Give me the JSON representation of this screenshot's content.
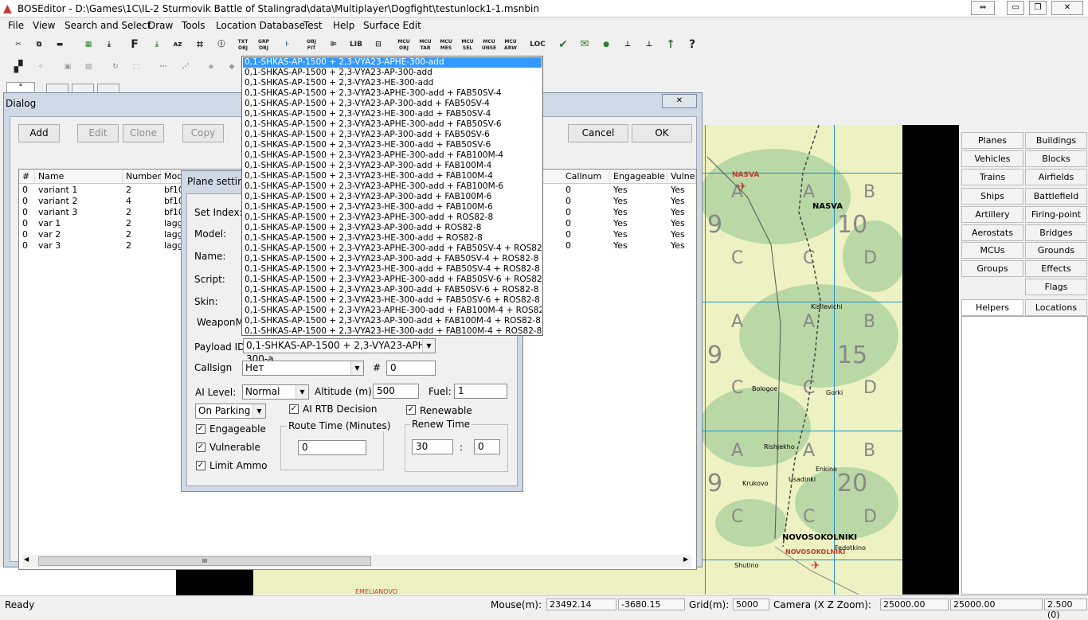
{
  "window": {
    "title": "BOSEditor - D:\\Games\\1C\\IL-2 Sturmovik Battle of Stalingrad\\data\\Multiplayer\\Dogfight\\testunlock1-1.msnbin",
    "ctrl_restore": "⇔",
    "min": "▭",
    "max": "❐",
    "close": "✕"
  },
  "menu": [
    "File",
    "View",
    "Search and Select",
    "Draw",
    "Tools",
    "Location Database",
    "Test",
    "Help",
    "Surface Edit"
  ],
  "toolbar1": [
    "✂",
    "⧉",
    "▬",
    "▦",
    "⤓",
    "F",
    "⤓",
    "ᴀᴢ",
    "⌗",
    "ⓘ",
    "TXT OBJ",
    "GRP OBJ",
    "⊦",
    "OBJ FIT",
    "⊫",
    "LIB",
    "⊟",
    "MCU OBJ",
    "MCU TAR",
    "MCU MES",
    "MCU SEL",
    "MCU UNSE",
    "MCU ARW",
    "LOC",
    "✔",
    "✉",
    "●",
    "⊥",
    "⊥",
    "↑",
    "?"
  ],
  "dialog": {
    "title": "Dialog",
    "close": "✕",
    "buttons": {
      "add": "Add",
      "edit": "Edit",
      "clone": "Clone",
      "copy": "Copy",
      "cancel": "Cancel",
      "ok": "OK"
    },
    "columns": {
      "idx": "#",
      "name": "Name",
      "number": "Number",
      "model": "Model",
      "callnum": "Callnum",
      "engageable": "Engageable",
      "vulnerable": "Vulne"
    },
    "rows": [
      {
        "idx": "0",
        "name": "variant 1",
        "number": "2",
        "model": "bf109f4",
        "callnum": "0",
        "eng": "Yes",
        "vul": "Yes"
      },
      {
        "idx": "0",
        "name": "variant 2",
        "number": "4",
        "model": "bf10",
        "callnum": "0",
        "eng": "Yes",
        "vul": "Yes"
      },
      {
        "idx": "0",
        "name": "variant 3",
        "number": "2",
        "model": "bf10",
        "callnum": "0",
        "eng": "Yes",
        "vul": "Yes"
      },
      {
        "idx": "0",
        "name": "var 1",
        "number": "2",
        "model": "lagg",
        "callnum": "0",
        "eng": "Yes",
        "vul": "Yes"
      },
      {
        "idx": "0",
        "name": "var 2",
        "number": "2",
        "model": "lagg",
        "callnum": "0",
        "eng": "Yes",
        "vul": "Yes"
      },
      {
        "idx": "0",
        "name": "var 3",
        "number": "2",
        "model": "lagg",
        "callnum": "0",
        "eng": "Yes",
        "vul": "Yes"
      }
    ],
    "hscroll": "III"
  },
  "plane": {
    "title": "Plane setting",
    "labels": {
      "set_index": "Set Index:",
      "model": "Model:",
      "name": "Name:",
      "script": "Script:",
      "skin": "Skin:",
      "weapon": "WeaponMod",
      "payload": "Payload ID:",
      "callsign": "Callsign",
      "hash": "#",
      "ai_level": "AI Level:",
      "altitude": "Altitude (m):",
      "fuel": "Fuel:",
      "rtb": "AI RTB Decision",
      "renewable": "Renewable",
      "engageable": "Engageable",
      "vulnerable": "Vulnerable",
      "limit_ammo": "Limit Ammo",
      "route_time": "Route Time (Minutes)",
      "renew_time": "Renew Time",
      "colon": ":"
    },
    "values": {
      "payload": "0,1-SHKAS-AP-1500 + 2,3-VYA23-APHE-300-a",
      "callsign": "Нет",
      "callsign_num": "0",
      "ai_level": "Normal",
      "altitude": "500",
      "fuel": "1",
      "parking": "On Parking",
      "route_time": "0",
      "renew_min": "30",
      "renew_sec": "0"
    },
    "check": "✓"
  },
  "payload_options": [
    "0,1-SHKAS-AP-1500 + 2,3-VYA23-APHE-300-add",
    "0,1-SHKAS-AP-1500 + 2,3-VYA23-AP-300-add",
    "0,1-SHKAS-AP-1500 + 2,3-VYA23-HE-300-add",
    "0,1-SHKAS-AP-1500 + 2,3-VYA23-APHE-300-add + FAB50SV-4",
    "0,1-SHKAS-AP-1500 + 2,3-VYA23-AP-300-add + FAB50SV-4",
    "0,1-SHKAS-AP-1500 + 2,3-VYA23-HE-300-add + FAB50SV-4",
    "0,1-SHKAS-AP-1500 + 2,3-VYA23-APHE-300-add + FAB50SV-6",
    "0,1-SHKAS-AP-1500 + 2,3-VYA23-AP-300-add + FAB50SV-6",
    "0,1-SHKAS-AP-1500 + 2,3-VYA23-HE-300-add + FAB50SV-6",
    "0,1-SHKAS-AP-1500 + 2,3-VYA23-APHE-300-add + FAB100M-4",
    "0,1-SHKAS-AP-1500 + 2,3-VYA23-AP-300-add + FAB100M-4",
    "0,1-SHKAS-AP-1500 + 2,3-VYA23-HE-300-add + FAB100M-4",
    "0,1-SHKAS-AP-1500 + 2,3-VYA23-APHE-300-add + FAB100M-6",
    "0,1-SHKAS-AP-1500 + 2,3-VYA23-AP-300-add + FAB100M-6",
    "0,1-SHKAS-AP-1500 + 2,3-VYA23-HE-300-add + FAB100M-6",
    "0,1-SHKAS-AP-1500 + 2,3-VYA23-APHE-300-add + ROS82-8",
    "0,1-SHKAS-AP-1500 + 2,3-VYA23-AP-300-add + ROS82-8",
    "0,1-SHKAS-AP-1500 + 2,3-VYA23-HE-300-add + ROS82-8",
    "0,1-SHKAS-AP-1500 + 2,3-VYA23-APHE-300-add + FAB50SV-4 + ROS82-8",
    "0,1-SHKAS-AP-1500 + 2,3-VYA23-AP-300-add + FAB50SV-4 + ROS82-8",
    "0,1-SHKAS-AP-1500 + 2,3-VYA23-HE-300-add + FAB50SV-4 + ROS82-8",
    "0,1-SHKAS-AP-1500 + 2,3-VYA23-APHE-300-add + FAB50SV-6 + ROS82-8",
    "0,1-SHKAS-AP-1500 + 2,3-VYA23-AP-300-add + FAB50SV-6 + ROS82-8",
    "0,1-SHKAS-AP-1500 + 2,3-VYA23-HE-300-add + FAB50SV-6 + ROS82-8",
    "0,1-SHKAS-AP-1500 + 2,3-VYA23-APHE-300-add + FAB100M-4 + ROS82-8",
    "0,1-SHKAS-AP-1500 + 2,3-VYA23-AP-300-add + FAB100M-4 + ROS82-8",
    "0,1-SHKAS-AP-1500 + 2,3-VYA23-HE-300-add + FAB100M-4 + ROS82-8"
  ],
  "map": {
    "labels": {
      "nasva1": "NASVA",
      "nasva2": "NASVA",
      "kislovichi": "Kisilevichi",
      "bologoe": "Bologoe",
      "gorki": "Gorki",
      "rishjekho": "Rishjekho",
      "enkino": "Enkino",
      "usadinki": "Usadinki",
      "krukovo": "Krukovo",
      "shutino": "Shutino",
      "fedotkino": "Fedotkino",
      "novo1": "NOVOSOKOLNIKI",
      "novo2": "NOVOSOKOLNIKI",
      "emel": "EMELIANOVO"
    },
    "grid": [
      "10",
      "15",
      "20",
      "9",
      "9",
      "9"
    ],
    "letters": [
      "A",
      "B",
      "C",
      "D"
    ]
  },
  "right_panel": [
    "Planes",
    "Buildings",
    "Vehicles",
    "Blocks",
    "Trains",
    "Airfields",
    "Ships",
    "Battlefield",
    "Artillery",
    "Firing-point",
    "Aerostats",
    "Bridges",
    "MCUs",
    "Grounds",
    "Groups",
    "Effects",
    "",
    "Flags",
    "Helpers",
    "Locations"
  ],
  "status": {
    "ready": "Ready",
    "mouse_label": "Mouse(m):",
    "mouse_x": "23492.14",
    "mouse_z": "-3680.15",
    "grid_label": "Grid(m):",
    "grid_val": "5000",
    "camera_label": "Camera (X Z Zoom):",
    "cam_x": "25000.00",
    "cam_z": "25000.00",
    "cam_zoom": "2.500 (0)"
  },
  "colors": {
    "selection": "#3399ff",
    "map_base": "#eef2c2",
    "forest": "#b9d8a6",
    "river": "#1f8fc4",
    "town": "#c0392b"
  }
}
